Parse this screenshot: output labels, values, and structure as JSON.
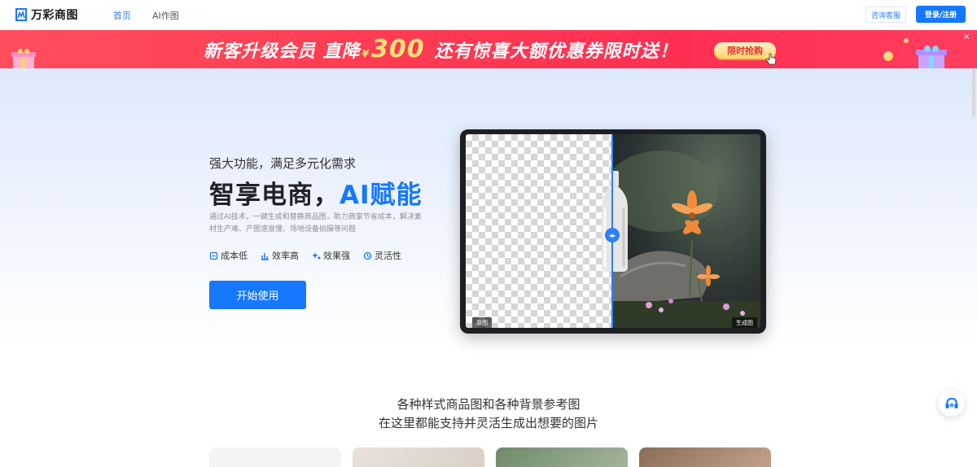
{
  "header": {
    "logo_text": "万彩商图",
    "nav": [
      {
        "label": "首页",
        "active": true
      },
      {
        "label": "AI作图",
        "active": false
      }
    ],
    "consult_label": "咨询客服",
    "login_label": "登录/注册"
  },
  "banner": {
    "text_before": "新客升级会员 直降",
    "currency": "¥",
    "amount": "300",
    "text_after": "还有惊喜大额优惠券限时送！",
    "button_label": "限时抢购",
    "close": "×"
  },
  "hero": {
    "subtitle": "强大功能，满足多元化需求",
    "title_main": "智享电商，",
    "title_accent": "AI赋能",
    "description": "通过AI技术，一键生成和替换商品图，助力商家节省成本，解决素材生产难、产图速度慢、场地设备拍摄等问题",
    "features": [
      {
        "label": "成本低",
        "icon": "cost-icon"
      },
      {
        "label": "效率高",
        "icon": "chart-icon"
      },
      {
        "label": "效果强",
        "icon": "sparkle-icon"
      },
      {
        "label": "灵活性",
        "icon": "flex-icon"
      }
    ],
    "start_label": "开始使用",
    "compare": {
      "left_tag": "原图",
      "right_tag": "生成图"
    }
  },
  "section": {
    "title_line1": "各种样式商品图和各种背景参考图",
    "title_line2": "在这里都能支持并灵活生成出想要的图片"
  },
  "colors": {
    "primary": "#1677ff",
    "banner": "#ff3b52",
    "accent_gold": "#ffe27a"
  }
}
